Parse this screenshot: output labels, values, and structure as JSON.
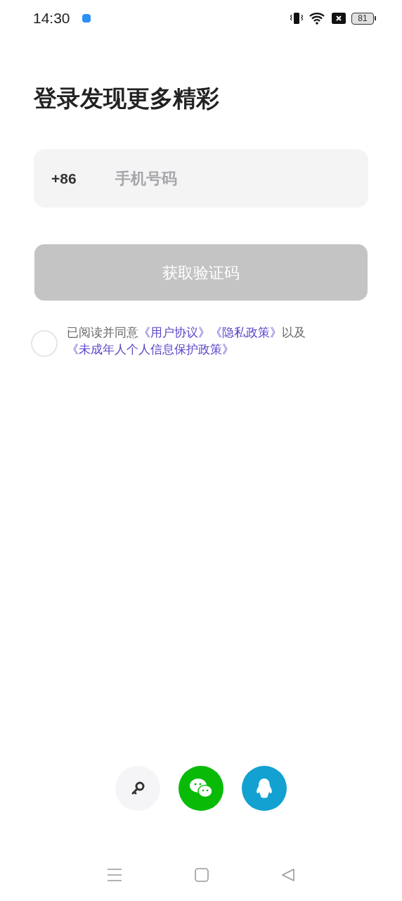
{
  "status_bar": {
    "time": "14:30",
    "battery": "81"
  },
  "title": "登录发现更多精彩",
  "phone_field": {
    "country_code": "+86",
    "placeholder": "手机号码"
  },
  "submit_button": {
    "label": "获取验证码",
    "disabled": true
  },
  "agreement": {
    "checked": false,
    "parts": [
      {
        "kind": "text",
        "text": "已阅读并同意"
      },
      {
        "kind": "link",
        "text": "《用户协议》"
      },
      {
        "kind": "link",
        "text": "《隐私政策》"
      },
      {
        "kind": "text",
        "text": "以及"
      },
      {
        "kind": "link",
        "text": "《未成年人个人信息保护政策》"
      }
    ]
  },
  "login_options": [
    {
      "kind": "key"
    },
    {
      "kind": "wechat"
    },
    {
      "kind": "qq"
    }
  ]
}
